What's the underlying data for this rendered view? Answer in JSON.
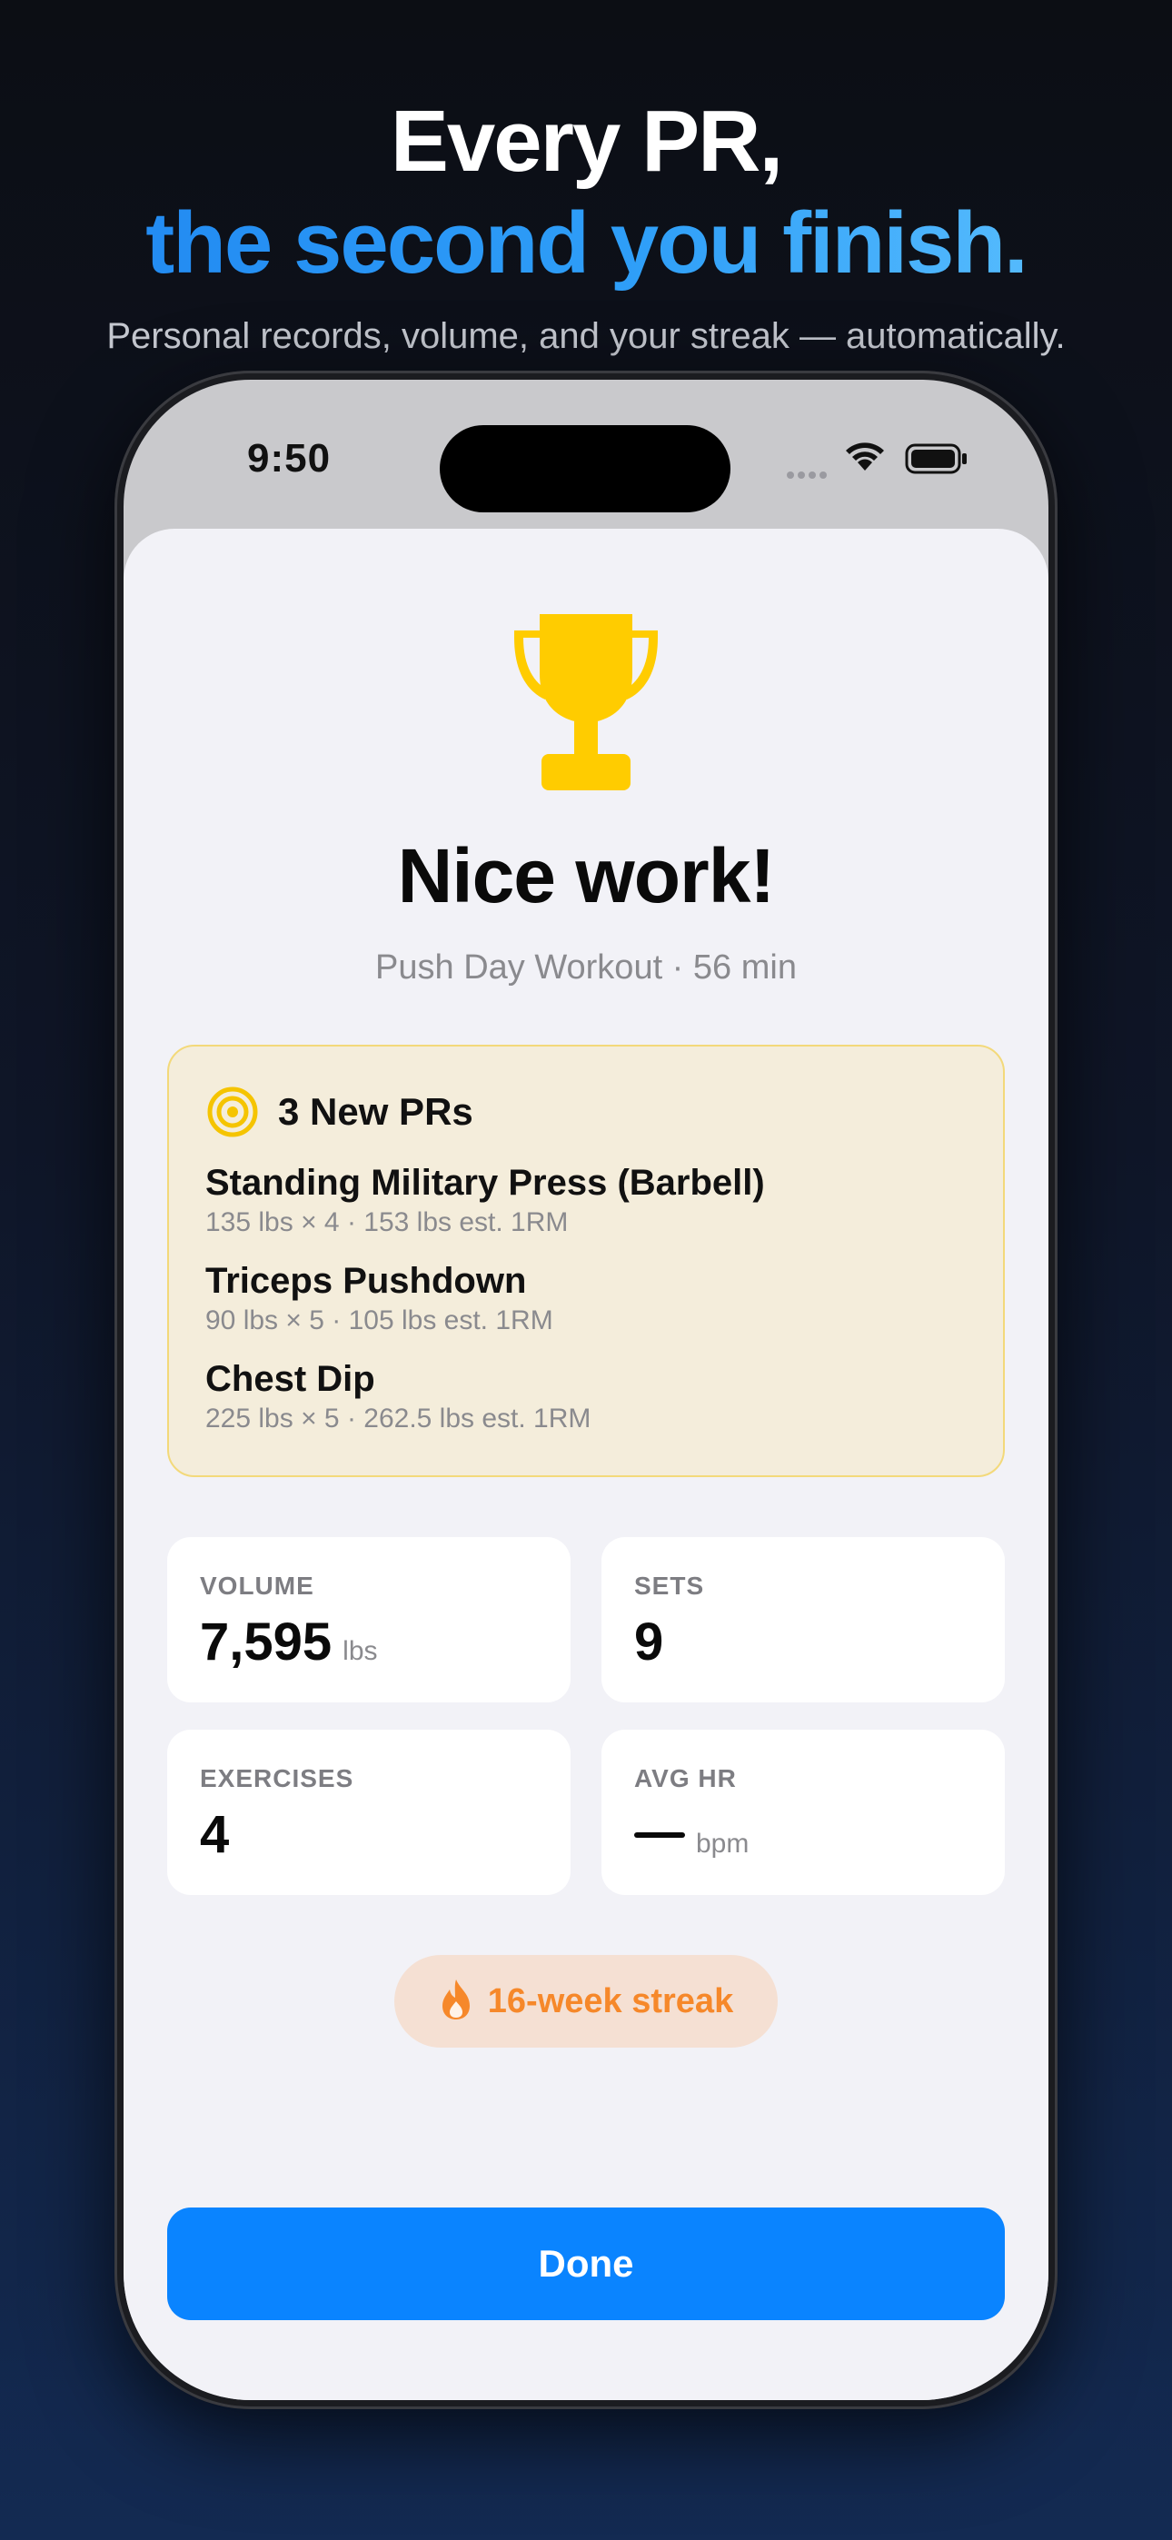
{
  "hero": {
    "line1": "Every PR,",
    "line2": "the second you finish.",
    "subtitle": "Personal records, volume, and your streak — automatically."
  },
  "status_bar": {
    "time": "9:50"
  },
  "summary": {
    "title": "Nice work!",
    "subtitle": "Push Day Workout · 56 min",
    "trophy_icon": "trophy-icon"
  },
  "prs": {
    "header": "3 New PRs",
    "icon": "target-icon",
    "items": [
      {
        "name": "Standing Military Press (Barbell)",
        "detail": "135 lbs × 4 · 153 lbs est. 1RM"
      },
      {
        "name": "Triceps Pushdown",
        "detail": "90 lbs × 5 · 105 lbs est. 1RM"
      },
      {
        "name": "Chest Dip",
        "detail": "225 lbs × 5 · 262.5 lbs est. 1RM"
      }
    ]
  },
  "stats": {
    "volume": {
      "label": "VOLUME",
      "value": "7,595",
      "unit": "lbs"
    },
    "sets": {
      "label": "SETS",
      "value": "9"
    },
    "exercises": {
      "label": "EXERCISES",
      "value": "4"
    },
    "avg_hr": {
      "label": "AVG HR",
      "value": "—",
      "unit": "bpm"
    }
  },
  "streak": {
    "label": "16-week streak",
    "icon": "flame-icon"
  },
  "done_button": {
    "label": "Done"
  },
  "colors": {
    "accent_blue": "#0a84ff",
    "trophy_yellow": "#ffcc00",
    "streak_orange": "#f6882a",
    "pr_card_bg": "#f4eddb"
  }
}
